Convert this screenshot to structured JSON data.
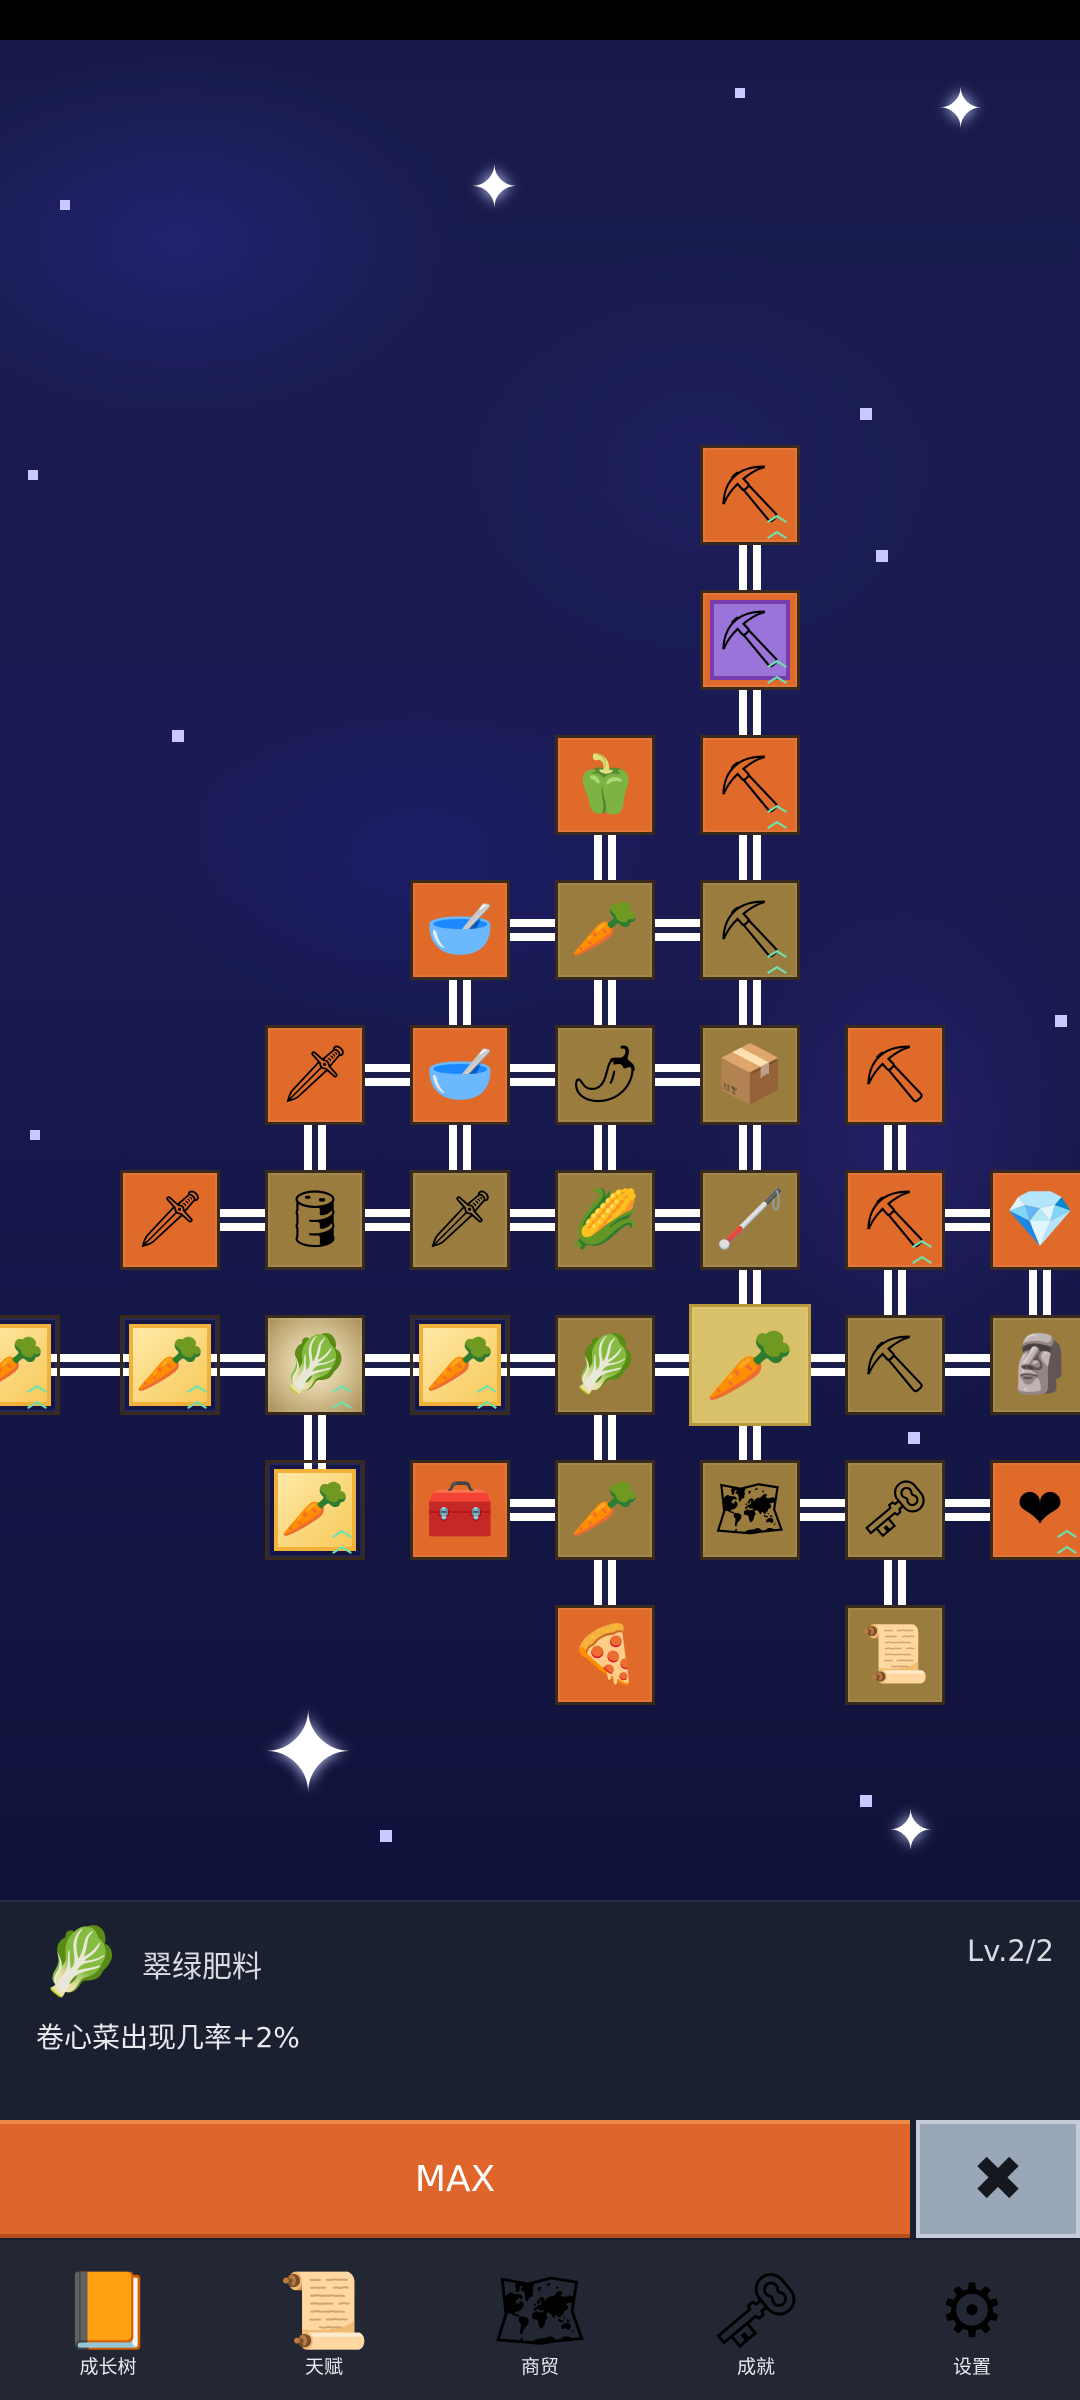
{
  "tree": {
    "nodes": [
      {
        "id": "n1",
        "icon": "shovel-icon",
        "glyph": "⛏",
        "style": "orange",
        "upgrade": true
      },
      {
        "id": "n2",
        "icon": "magic-shovel-icon",
        "glyph": "⛏",
        "style": "purple",
        "upgrade": true
      },
      {
        "id": "n3",
        "icon": "pepper-icon",
        "glyph": "🫑",
        "style": "orange",
        "upgrade": false
      },
      {
        "id": "n4",
        "icon": "shovel-icon",
        "glyph": "⛏",
        "style": "orange",
        "upgrade": true
      },
      {
        "id": "n5",
        "icon": "soup-bowl-icon",
        "glyph": "🥣",
        "style": "orange",
        "upgrade": false
      },
      {
        "id": "n6",
        "icon": "radish-icon",
        "glyph": "🥕",
        "style": "olive",
        "upgrade": false
      },
      {
        "id": "n7",
        "icon": "shovel-icon",
        "glyph": "⛏",
        "style": "olive",
        "upgrade": true
      },
      {
        "id": "n8",
        "icon": "golden-sword-icon",
        "glyph": "🗡",
        "style": "orange",
        "upgrade": false
      },
      {
        "id": "n9",
        "icon": "bowl-icon",
        "glyph": "🥣",
        "style": "orange",
        "upgrade": false
      },
      {
        "id": "n10",
        "icon": "chili-icon",
        "glyph": "🌶",
        "style": "olive",
        "upgrade": false
      },
      {
        "id": "n11",
        "icon": "crate-icon",
        "glyph": "📦",
        "style": "olive",
        "upgrade": false
      },
      {
        "id": "n12",
        "icon": "pickaxe-icon",
        "glyph": "⛏",
        "style": "orange",
        "upgrade": false
      },
      {
        "id": "n13",
        "icon": "sword-icon",
        "glyph": "🗡",
        "style": "orange",
        "upgrade": false
      },
      {
        "id": "n14",
        "icon": "barrel-icon",
        "glyph": "🛢",
        "style": "olive",
        "upgrade": false
      },
      {
        "id": "n15",
        "icon": "sword-icon",
        "glyph": "🗡",
        "style": "olive",
        "upgrade": false
      },
      {
        "id": "n16",
        "icon": "corn-icon",
        "glyph": "🌽",
        "style": "olive",
        "upgrade": false
      },
      {
        "id": "n17",
        "icon": "stick-icon",
        "glyph": "🦯",
        "style": "olive",
        "upgrade": false
      },
      {
        "id": "n18",
        "icon": "pickaxe-icon",
        "glyph": "⛏",
        "style": "orange",
        "upgrade": true
      },
      {
        "id": "n19",
        "icon": "crystal-icon",
        "glyph": "💎",
        "style": "orange",
        "upgrade": false
      },
      {
        "id": "n20",
        "icon": "carrot-icon",
        "glyph": "🥕",
        "style": "gold-frame",
        "upgrade": true
      },
      {
        "id": "n21",
        "icon": "cabbage-icon",
        "glyph": "🥬",
        "style": "burst",
        "upgrade": true
      },
      {
        "id": "n22",
        "icon": "carrot-icon",
        "glyph": "🥕",
        "style": "gold-frame",
        "upgrade": true
      },
      {
        "id": "n23",
        "icon": "cabbage-icon",
        "glyph": "🥬",
        "style": "olive",
        "upgrade": false
      },
      {
        "id": "n24",
        "icon": "carrot-icon",
        "glyph": "🥕",
        "style": "selected",
        "upgrade": false
      },
      {
        "id": "n25",
        "icon": "pickaxe-icon",
        "glyph": "⛏",
        "style": "olive",
        "upgrade": false
      },
      {
        "id": "n26",
        "icon": "statue-icon",
        "glyph": "🗿",
        "style": "olive",
        "upgrade": false
      },
      {
        "id": "n27",
        "icon": "carrot-icon",
        "glyph": "🥕",
        "style": "gold-frame",
        "upgrade": true
      },
      {
        "id": "n28",
        "icon": "treasure-chest-icon",
        "glyph": "🧰",
        "style": "orange",
        "upgrade": false
      },
      {
        "id": "n29",
        "icon": "parsnip-icon",
        "glyph": "🥕",
        "style": "olive",
        "upgrade": false
      },
      {
        "id": "n30",
        "icon": "map-icon",
        "glyph": "🗺",
        "style": "olive",
        "upgrade": false
      },
      {
        "id": "n31",
        "icon": "key-icon",
        "glyph": "🗝",
        "style": "olive",
        "upgrade": false
      },
      {
        "id": "n32",
        "icon": "heart-icon",
        "glyph": "❤",
        "style": "orange",
        "upgrade": true
      },
      {
        "id": "n33",
        "icon": "pizza-icon",
        "glyph": "🍕",
        "style": "orange",
        "upgrade": false
      },
      {
        "id": "n34",
        "icon": "scroll-icon",
        "glyph": "📜",
        "style": "olive",
        "upgrade": false
      },
      {
        "id": "n35",
        "icon": "carrot-icon",
        "glyph": "🥕",
        "style": "gold-frame",
        "upgrade": true
      }
    ]
  },
  "detail": {
    "icon": "cabbage-icon",
    "icon_glyph": "🥬",
    "title": "翠绿肥料",
    "level": "Lv.2/2",
    "description": "卷心菜出现几率+2%"
  },
  "actions": {
    "max_label": "MAX",
    "close_icon": "close-icon",
    "close_glyph": "✖"
  },
  "nav": [
    {
      "id": "growth-tree",
      "label": "成长树",
      "icon": "book-icon",
      "glyph": "📙"
    },
    {
      "id": "talent",
      "label": "天赋",
      "icon": "scroll-icon",
      "glyph": "📜"
    },
    {
      "id": "trade",
      "label": "商贸",
      "icon": "map-icon",
      "glyph": "🗺"
    },
    {
      "id": "achievement",
      "label": "成就",
      "icon": "key-icon",
      "glyph": "🗝"
    },
    {
      "id": "settings",
      "label": "设置",
      "icon": "gear-icon",
      "glyph": "⚙"
    }
  ]
}
